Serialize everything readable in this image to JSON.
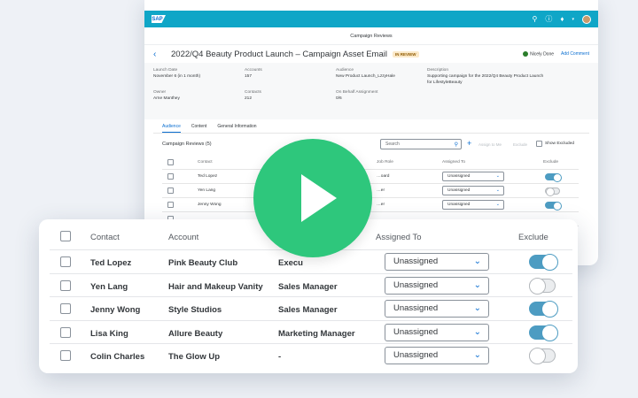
{
  "shell": {
    "logo": "SAP",
    "icons": [
      "search-icon",
      "help-icon",
      "bell-icon",
      "chevron-down-icon",
      "avatar"
    ]
  },
  "page": {
    "subtitle": "Campaign Reviews"
  },
  "object": {
    "title": "2022/Q4 Beauty Product Launch – Campaign Asset Email",
    "status": "IN REVIEW",
    "action_done": "Nicely Done",
    "action_comment": "Add Comment"
  },
  "facets": {
    "launch_date_label": "Launch Date",
    "launch_date": "November 6 (in 1 month)",
    "accounts_label": "Accounts",
    "accounts": "157",
    "audience_label": "Audience",
    "audience": "New Product Launch_LzzyHale",
    "description_label": "Description",
    "description_1": "Supporting campaign for the 2022/Q4 Beauty Product Launch",
    "description_2": "for LifestyleBeauty",
    "owner_label": "Owner",
    "owner": "Arne Manthey",
    "contacts_label": "Contacts",
    "contacts": "212",
    "on_behalf_label": "On Behalf Assignment",
    "on_behalf": "0/6"
  },
  "tabs": [
    "Audience",
    "Content",
    "General Information"
  ],
  "toolbar": {
    "title": "Campaign Reviews (5)",
    "search_placeholder": "Search",
    "assign": "Assign to Me",
    "exclude": "Exclude",
    "show_excluded": "Show Excluded"
  },
  "back_table": {
    "headers": {
      "contact": "Contact",
      "role": "Job Role",
      "assigned": "Assigned To",
      "exclude": "Exclude"
    },
    "rows": [
      {
        "contact": "Ted Lopez",
        "role": "…oard",
        "assigned": "Unassigned",
        "exclude": true
      },
      {
        "contact": "Yen Lang",
        "role": "…er",
        "assigned": "Unassigned",
        "exclude": false
      },
      {
        "contact": "Jenny Wong",
        "role": "…er",
        "assigned": "Unassigned",
        "exclude": true
      }
    ]
  },
  "front_table": {
    "headers": {
      "contact": "Contact",
      "account": "Account",
      "assigned": "Assigned To",
      "exclude": "Exclude"
    },
    "rows": [
      {
        "contact": "Ted Lopez",
        "account": "Pink Beauty Club",
        "role": "Execu",
        "assigned": "Unassigned",
        "exclude": true
      },
      {
        "contact": "Yen Lang",
        "account": "Hair and Makeup Vanity",
        "role": "Sales Manager",
        "assigned": "Unassigned",
        "exclude": false
      },
      {
        "contact": "Jenny Wong",
        "account": "Style Studios",
        "role": "Sales Manager",
        "assigned": "Unassigned",
        "exclude": true
      },
      {
        "contact": "Lisa King",
        "account": "Allure Beauty",
        "role": "Marketing Manager",
        "assigned": "Unassigned",
        "exclude": true
      },
      {
        "contact": "Colin Charles",
        "account": "The Glow Up",
        "role": "-",
        "assigned": "Unassigned",
        "exclude": false
      }
    ]
  },
  "colors": {
    "shell": "#0fa6c7",
    "accent": "#0a6ed1",
    "toggle_on": "#4d9cc2",
    "play": "#2ec77c"
  }
}
